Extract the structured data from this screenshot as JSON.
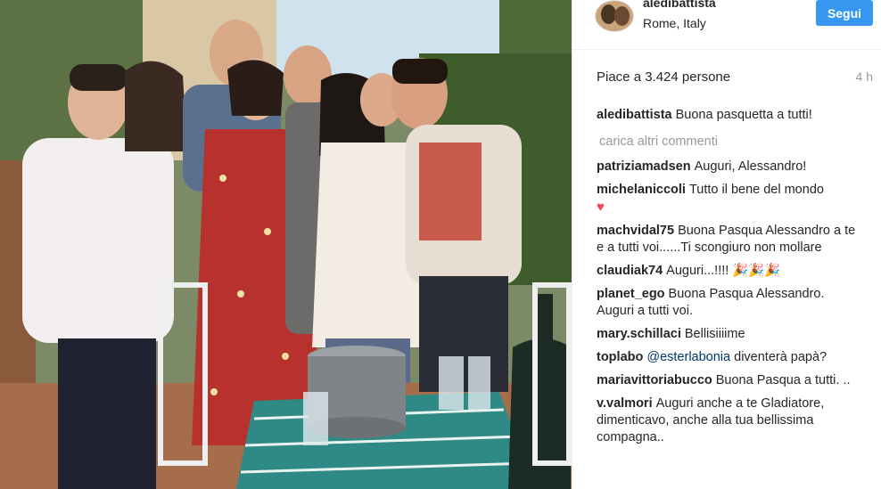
{
  "post": {
    "username": "aledibattista",
    "location": "Rome, Italy",
    "follow_label": "Segui",
    "likes_text": "Piace a 3.424 persone",
    "time_ago": "4 h"
  },
  "caption": {
    "user": "aledibattista",
    "text": "Buona pasquetta a tutti!"
  },
  "load_more_label": "carica altri commenti",
  "comments": [
    {
      "user": "patriziamadsen",
      "text": "Auguri, Alessandro!"
    },
    {
      "user": "michelaniccoli",
      "text": "Tutto il bene del mondo",
      "emoji": "♥"
    },
    {
      "user": "machvidal75",
      "text": "Buona Pasqua Alessandro a te e a tutti voi......Ti scongiuro non mollare"
    },
    {
      "user": "claudiak74",
      "text": "Auguri...!!!!",
      "emoji": "🎉🎉🎉"
    },
    {
      "user": "planet_ego",
      "text": "Buona Pasqua Alessandro. Auguri a tutti voi."
    },
    {
      "user": "mary.schillaci",
      "text": "Bellisiiiime"
    },
    {
      "user": "toplabo",
      "mention": "@esterlabonia",
      "text": "diventerà papà?"
    },
    {
      "user": "mariavittoriabucco",
      "text": "Buona Pasqua a tutti. .."
    },
    {
      "user": "v.valmori",
      "text": "Auguri anche a te Gladiatore, dimenticavo, anche alla tua bellissima compagna.."
    }
  ],
  "colors": {
    "follow_button": "#3897f0",
    "text": "#262626",
    "muted": "#999999",
    "heart": "#ed4956"
  },
  "icons": {
    "heart": "heart-icon"
  }
}
